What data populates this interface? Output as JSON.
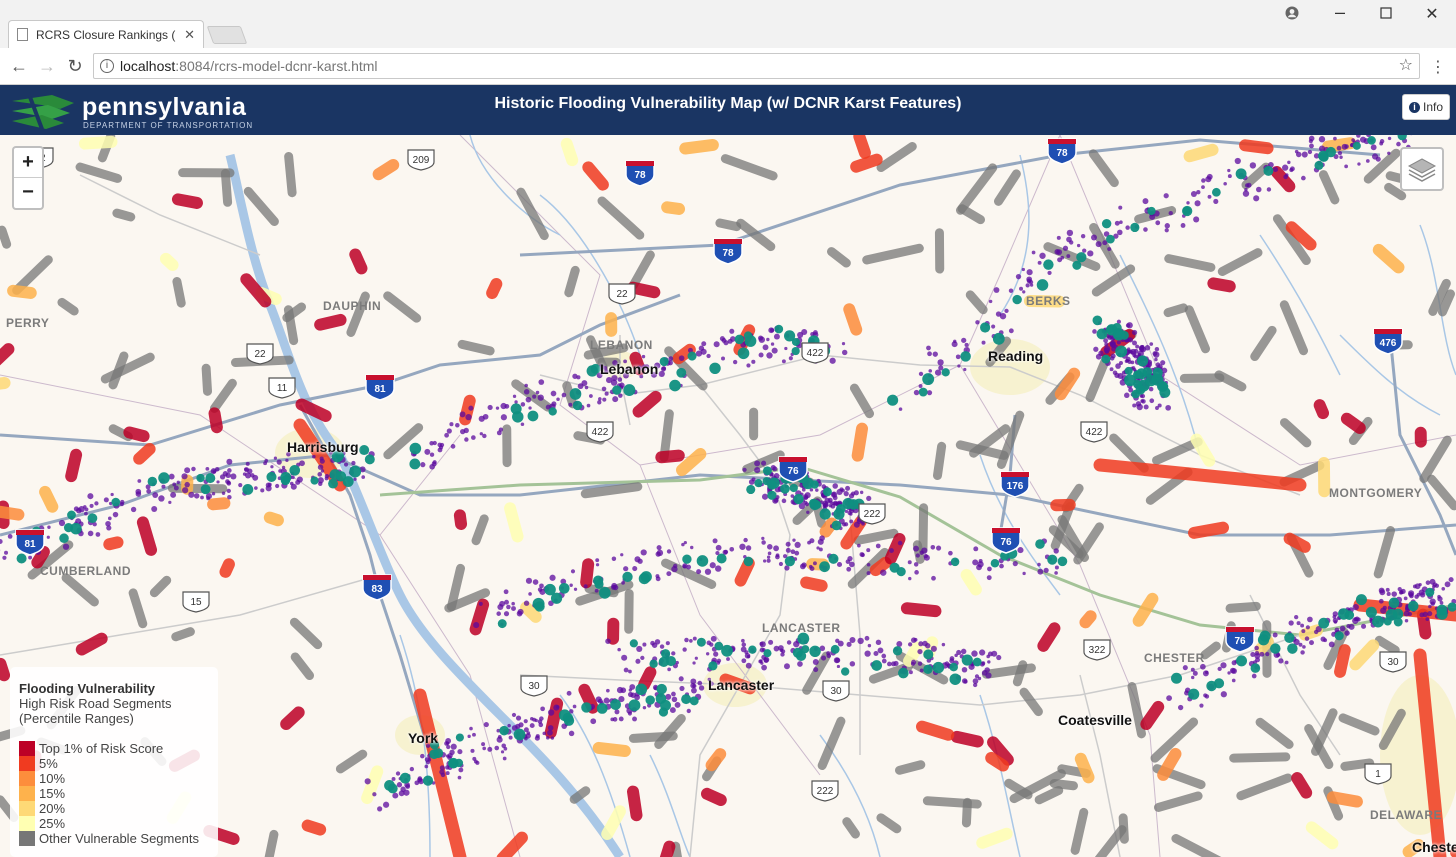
{
  "browser": {
    "tab_title": "RCRS Closure Rankings (",
    "url_host": "localhost",
    "url_path": ":8084/rcrs-model-dcnr-karst.html"
  },
  "header": {
    "logo_name": "pennsylvania",
    "logo_sub": "DEPARTMENT OF TRANSPORTATION",
    "title": "Historic Flooding Vulnerability Map (w/ DCNR Karst Features)",
    "info_label": "Info"
  },
  "map": {
    "zoom_in": "+",
    "zoom_out": "−",
    "county_labels": {
      "perry": "PERRY",
      "dauphin": "DAUPHIN",
      "lebanon": "LEBANON",
      "berks": "BERKS",
      "montgomery": "MONTGOMERY",
      "chester": "CHESTER",
      "lancaster": "LANCASTER",
      "delaware": "DELAWARE",
      "cumberland": "CUMBERLAND"
    },
    "city_labels": {
      "harrisburg": "Harrisburg",
      "lebanon": "Lebanon",
      "reading": "Reading",
      "lancaster": "Lancaster",
      "york": "York",
      "coatesville": "Coatesville",
      "chester": "Chester"
    },
    "shields": {
      "i78a": "78",
      "i78b": "78",
      "i81": "81",
      "i76a": "76",
      "i76b": "76",
      "i76c": "76",
      "i176": "176",
      "i476": "476",
      "i83": "83",
      "i81b": "81",
      "i78c": "78",
      "us22a": "22",
      "us22b": "22",
      "us22c": "22",
      "us11": "11",
      "us422a": "422",
      "us422b": "422",
      "us422c": "422",
      "us222": "222",
      "us322": "322",
      "us30a": "30",
      "us30b": "30",
      "us30c": "30",
      "us15": "15",
      "us209": "209",
      "us1": "1",
      "us222b": "222"
    }
  },
  "legend": {
    "title": "Flooding Vulnerability",
    "subtitle1": "High Risk Road Segments",
    "subtitle2": "(Percentile Ranges)",
    "items": [
      {
        "label": "Top 1% of Risk Score",
        "color": "#bd0026"
      },
      {
        "label": "5%",
        "color": "#f03b20"
      },
      {
        "label": "10%",
        "color": "#fd8d3c"
      },
      {
        "label": "15%",
        "color": "#feb24c"
      },
      {
        "label": "20%",
        "color": "#fed976"
      },
      {
        "label": "25%",
        "color": "#ffffb2"
      },
      {
        "label": "Other Vulnerable Segments",
        "color": "#777777"
      }
    ]
  },
  "colors": {
    "header_bg": "#1a3563",
    "karst_purple": "#5b0a9e",
    "karst_teal": "#0f8f80",
    "other_gray": "#777777",
    "interstate_blue": "#1f4fb3",
    "interstate_red": "#c8102e"
  }
}
